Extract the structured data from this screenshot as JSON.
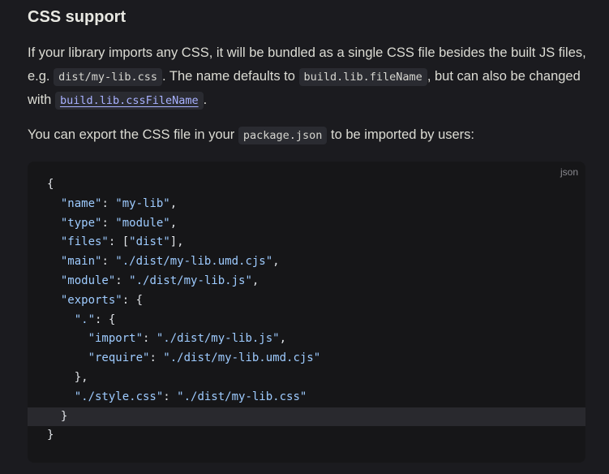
{
  "section": {
    "title": "CSS support"
  },
  "paragraph1": {
    "t1": "If your library imports any CSS, it will be bundled as a single CSS file besides the built JS files, e.g. ",
    "code1": "dist/my-lib.css",
    "t2": ". The name defaults to ",
    "code2": "build.lib.fileName",
    "t3": ", but can also be changed with ",
    "code3": "build.lib.cssFileName",
    "t4": "."
  },
  "paragraph2": {
    "t1": "You can export the CSS file in your ",
    "code1": "package.json",
    "t2": " to be imported by users:"
  },
  "codeblock": {
    "language": "json",
    "lines": [
      "{",
      "  \"name\": \"my-lib\",",
      "  \"type\": \"module\",",
      "  \"files\": [\"dist\"],",
      "  \"main\": \"./dist/my-lib.umd.cjs\",",
      "  \"module\": \"./dist/my-lib.js\",",
      "  \"exports\": {",
      "    \".\": {",
      "      \"import\": \"./dist/my-lib.js\",",
      "      \"require\": \"./dist/my-lib.umd.cjs\"",
      "    },",
      "    \"./style.css\": \"./dist/my-lib.css\"",
      "  }",
      "}"
    ],
    "highlighted_line": 12
  }
}
